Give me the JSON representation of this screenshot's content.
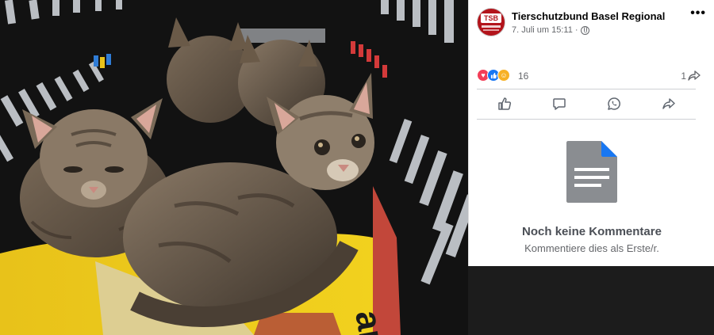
{
  "post": {
    "page_name": "Tierschutzbund Basel Regional",
    "avatar_logo_text": "TSB",
    "date": "7. Juli um 15:11",
    "separator": "·",
    "privacy_icon": "globe-icon",
    "more_icon": "more-dots-icon",
    "more_glyph": "•••"
  },
  "reactions": {
    "icons": [
      "love-reaction-icon",
      "like-reaction-icon",
      "care-reaction-icon"
    ],
    "count": "16",
    "shares": "1",
    "share_icon": "share-arrow-icon"
  },
  "actions": [
    {
      "icon": "like-thumb-icon"
    },
    {
      "icon": "comment-bubble-icon"
    },
    {
      "icon": "whatsapp-icon"
    },
    {
      "icon": "share-icon"
    }
  ],
  "comments": {
    "empty_title": "Noch keine Kommentare",
    "empty_sub": "Kommentiere dies als Erste/r.",
    "empty_icon": "document-icon"
  },
  "photo": {
    "subject": "kittens-in-carrier-photo",
    "blanket_text": "ar"
  },
  "colors": {
    "brand_red": "#b3141b",
    "like_blue": "#1877f2",
    "love_red": "#f33e58",
    "care_yellow": "#f7b125",
    "doc_gray": "#8a8d91",
    "doc_fold": "#1877f2"
  }
}
